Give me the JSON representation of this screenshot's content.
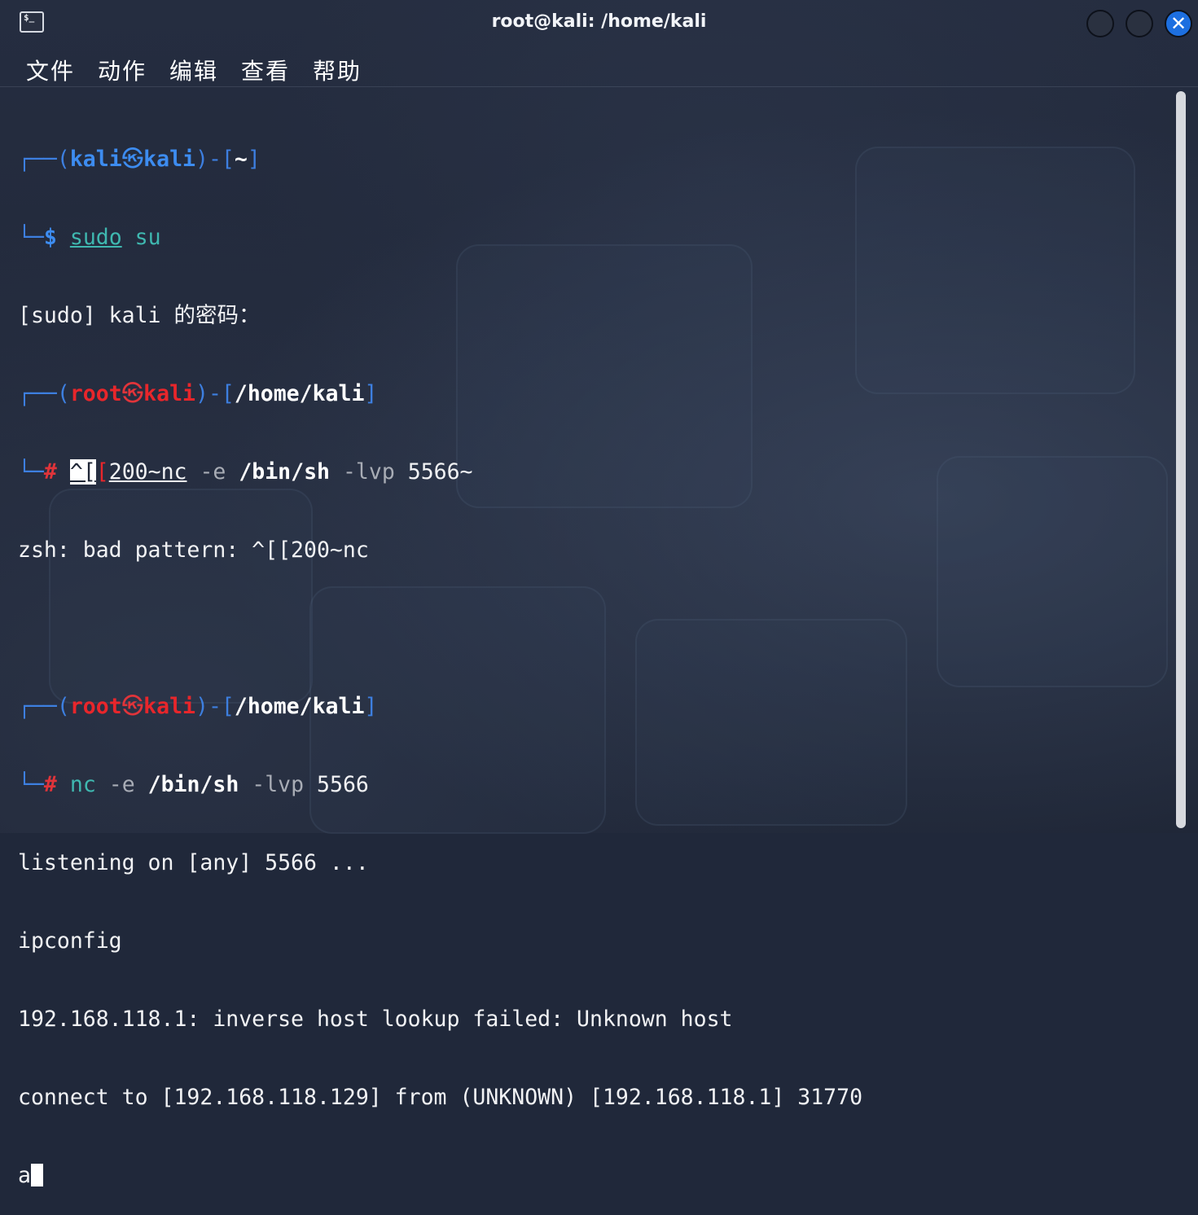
{
  "window": {
    "title": "root@kali: /home/kali",
    "terminal_icon_glyph": "$_"
  },
  "controls": {
    "close_glyph": "✕"
  },
  "menu": {
    "items": [
      "文件",
      "动作",
      "编辑",
      "查看",
      "帮助"
    ]
  },
  "terminal": {
    "l1": {
      "box": "┌──(",
      "user": "kali",
      "at": "㉿",
      "host": "kali",
      "mid": ")-[",
      "dir": "~",
      "end": "]"
    },
    "l2": {
      "box": "└─",
      "prompt": "$",
      "cmd": "sudo",
      "arg": " su"
    },
    "l3": "[sudo] kali 的密码：",
    "l4": {
      "box": "┌──(",
      "user": "root",
      "at": "㉿",
      "host": "kali",
      "mid": ")-[",
      "dir": "/home/kali",
      "end": "]"
    },
    "l5": {
      "box": "└─",
      "prompt": "#",
      "esc1": "^[",
      "esc2": "[",
      "cmd": "200~nc",
      "opt1": " -e ",
      "path": "/bin/sh",
      "opt2": " -lvp ",
      "rest": "5566~"
    },
    "l6": "zsh: bad pattern: ^[[200~nc",
    "l8": {
      "box": "┌──(",
      "user": "root",
      "at": "㉿",
      "host": "kali",
      "mid": ")-[",
      "dir": "/home/kali",
      "end": "]"
    },
    "l9": {
      "box": "└─",
      "prompt": "#",
      "cmd": "nc",
      "opt1": " -e ",
      "path": "/bin/sh",
      "opt2": " -lvp ",
      "rest": "5566"
    },
    "l10": "listening on [any] 5566 ...",
    "l11": "ipconfig",
    "l12": "192.168.118.1: inverse host lookup failed: Unknown host",
    "l13": "connect to [192.168.118.129] from (UNKNOWN) [192.168.118.1] 31770",
    "l14": "a"
  },
  "colors": {
    "background": "#20283a",
    "prompt_blue": "#3d8cf0",
    "root_red": "#e8262b",
    "command_teal": "#3fb8b0",
    "close_button": "#1d6fe0"
  }
}
